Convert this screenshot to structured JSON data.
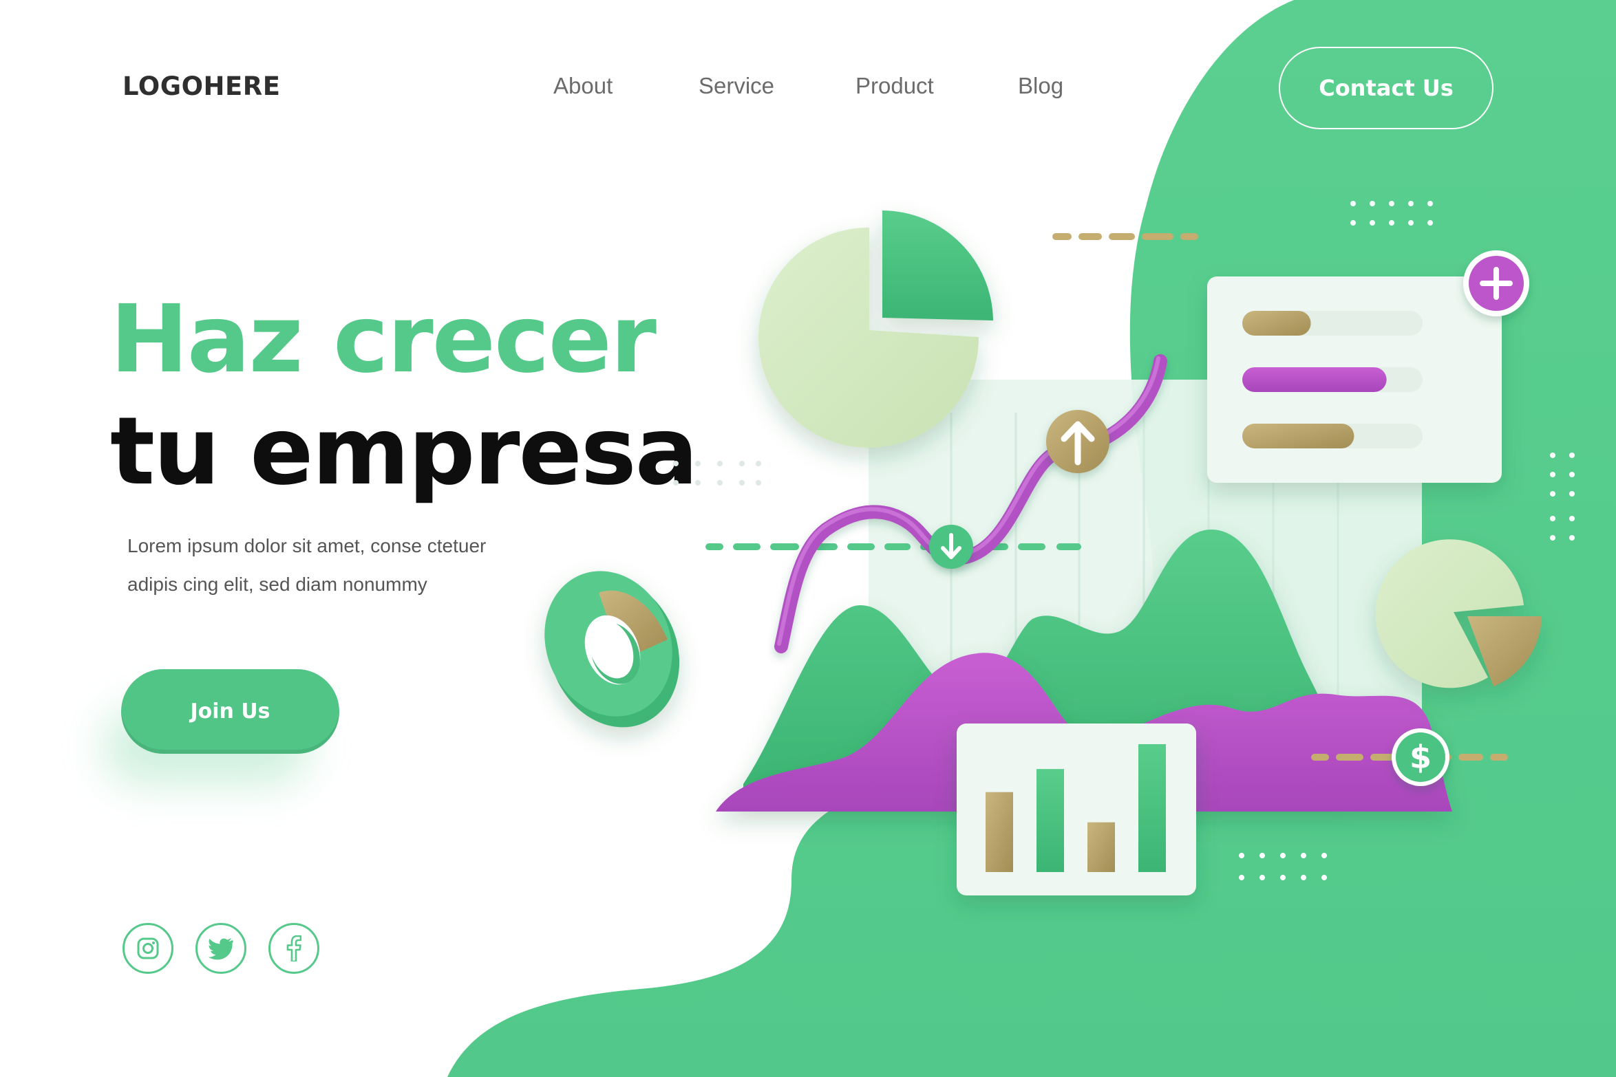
{
  "header": {
    "logo": "LOGOHERE",
    "nav": [
      "About",
      "Service",
      "Product",
      "Blog"
    ],
    "contact_label": "Contact Us"
  },
  "hero": {
    "title_line1": "Haz crecer",
    "title_line2": "tu empresa",
    "description_line1": "Lorem ipsum dolor sit amet, conse ctetuer",
    "description_line2": "adipis cing elit, sed diam nonummy",
    "cta_label": "Join Us"
  },
  "social": [
    "instagram-icon",
    "twitter-icon",
    "facebook-icon"
  ],
  "colors": {
    "green": "#54c98a",
    "dark_green": "#3fb877",
    "pale_green": "#d6eac2",
    "purple": "#b955c8",
    "gold": "#b8a36a",
    "text_dark": "#0e0e0e",
    "nav_gray": "#6b6b6b"
  },
  "illustration": {
    "panel_bars": [
      0.38,
      0.8,
      0.62
    ],
    "bar_chart": {
      "values": [
        0.45,
        0.58,
        0.28,
        0.72
      ],
      "colors": [
        "gold",
        "green",
        "gold",
        "green"
      ]
    },
    "icons": [
      "arrow-up-icon",
      "arrow-down-icon",
      "plus-icon",
      "dollar-icon"
    ]
  }
}
